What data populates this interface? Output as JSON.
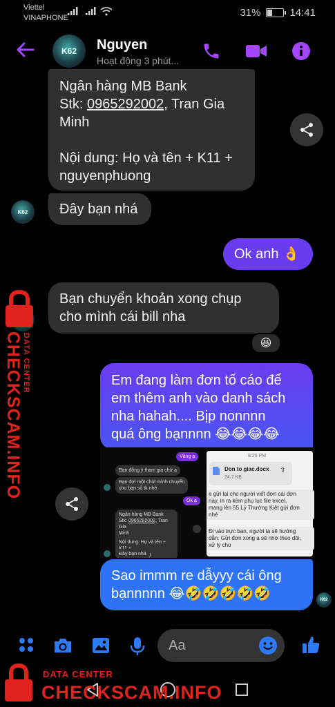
{
  "status_bar": {
    "carrier_1": "Viettel",
    "carrier_2": "VINAPHONE",
    "battery": "31%",
    "time": "14:41"
  },
  "header": {
    "avatar_text": "K62",
    "name": "Nguyen",
    "activity": "Hoạt động 3 phút..."
  },
  "messages": {
    "m1_line1": "Ngân hàng MB Bank",
    "m1_stk_label": "Stk: ",
    "m1_stk_number": "0965292002",
    "m1_stk_rest": ", Tran Gia",
    "m1_line3": "Minh",
    "m1_line4": "Nội dung: Họ và tên + K11 +",
    "m1_line5": "nguyenphuong",
    "m2": "Đây bạn nhá",
    "m3": "Ok anh 👌",
    "m4_line1": "Bạn chuyển khoản xong chụp",
    "m4_line2": "cho mình cái bill nha",
    "m4_reaction": "😆",
    "m5_line1": "Em đang làm đơn tố cáo để",
    "m5_line2": "em thêm anh vào danh sách",
    "m5_line3": "nha hahah.... Bịp nonnnn",
    "m5_line4": "quá ông bạnnnn 😂😂😂😂",
    "m7_line1": "Sao immm re dẫyyy cái ông",
    "m7_line2": "bạnnnnn 😂🤣🤣🤣🤣🤣"
  },
  "embedded_screenshot": {
    "left": {
      "pill_1": "Vâng ạ",
      "msg_1": "Bạn đồng ý tham gia chứ ạ",
      "msg_2_line1": "Bạn đợi một chút mình chuyển",
      "msg_2_line2": "cho bạn số tk nhé",
      "pill_2": "Ok ạ",
      "bank_1": "Ngân hàng MB Bank",
      "bank_2_label": "Stk: ",
      "bank_2_number": "0965292002",
      "bank_2_rest": ", Tran Gia",
      "bank_3": "Minh",
      "bank_4": "Nội dung: Họ và tên + K11 +",
      "bank_5": "nguyenphuong",
      "msg_3": "Đây bạn nhá"
    },
    "right": {
      "time": "8:25 PM",
      "file_name": "Don to giac.docx",
      "file_size": "24.7 KB",
      "text_1": "e gửi lại cho người viết đơn cái đơn",
      "text_2": "này, in ra kèm phụ lục file excel,",
      "text_3": "mang lên 55 Lý Thường Kiệt gửi đơn",
      "text_4": "nhé",
      "text_5": "Đi vào trực ban, người ta sẽ hướng",
      "text_6": "dẫn. Gửi đơn xong a sẽ nhờ theo dõi,",
      "text_7": "xử lý cho"
    }
  },
  "composer": {
    "placeholder": "Aa"
  },
  "watermark": {
    "top": "DATA CENTER",
    "bottom": "CHECKSCAM.INFO"
  },
  "colors": {
    "accent": "#a445ff",
    "outgoing_top": "#6a3cf0",
    "outgoing_bottom": "#2e73f5",
    "incoming": "#303030",
    "watermark": "#e0231c"
  }
}
